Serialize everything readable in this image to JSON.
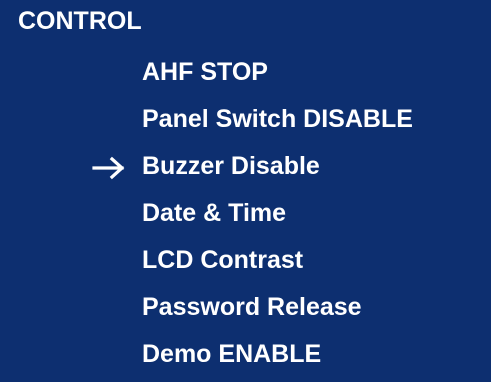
{
  "screen": {
    "title": "CONTROL",
    "cursor_icon": "right-arrow-icon",
    "selected_index": 2,
    "colors": {
      "background": "#0d2f70",
      "text": "#ffffff"
    }
  },
  "menu": {
    "items": [
      {
        "label": "AHF STOP"
      },
      {
        "label": "Panel Switch DISABLE"
      },
      {
        "label": "Buzzer Disable"
      },
      {
        "label": "Date & Time"
      },
      {
        "label": "LCD Contrast"
      },
      {
        "label": "Password Release"
      },
      {
        "label": "Demo ENABLE"
      }
    ]
  }
}
